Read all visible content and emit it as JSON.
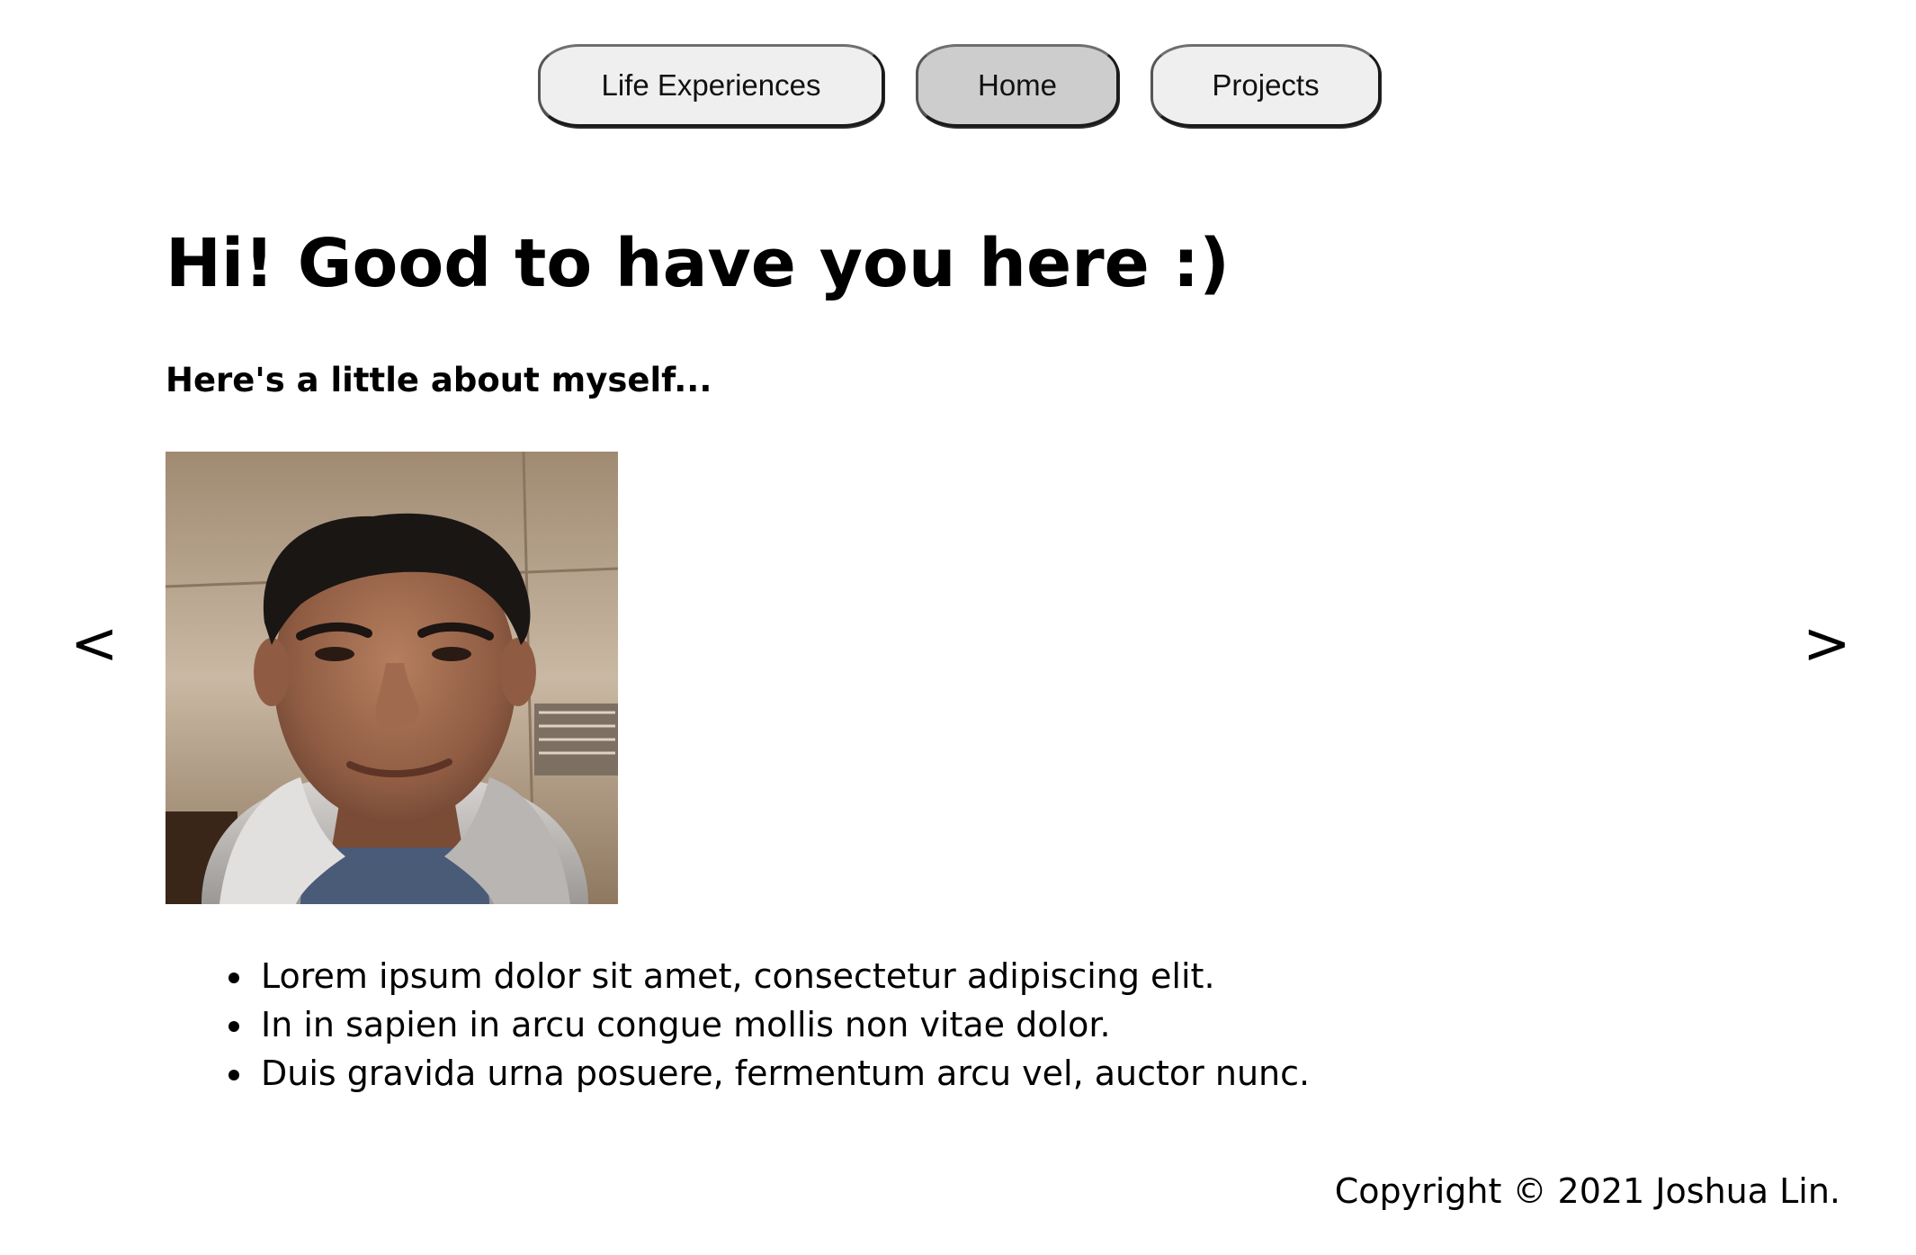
{
  "nav": {
    "items": [
      {
        "label": "Life Experiences",
        "active": false
      },
      {
        "label": "Home",
        "active": true
      },
      {
        "label": "Projects",
        "active": false
      }
    ]
  },
  "main": {
    "heading": "Hi! Good to have you here :)",
    "subheading": "Here's a little about myself...",
    "carousel": {
      "prev_label": "<",
      "next_label": ">"
    },
    "bullets": [
      "Lorem ipsum dolor sit amet, consectetur adipiscing elit.",
      "In in sapien in arcu congue mollis non vitae dolor.",
      "Duis gravida urna posuere, fermentum arcu vel, auctor nunc."
    ]
  },
  "footer": {
    "copyright": "Copyright © 2021 Joshua Lin."
  },
  "colors": {
    "nav_button_bg": "#efefef",
    "nav_button_active_bg": "#cdcdcd",
    "text": "#000000"
  }
}
